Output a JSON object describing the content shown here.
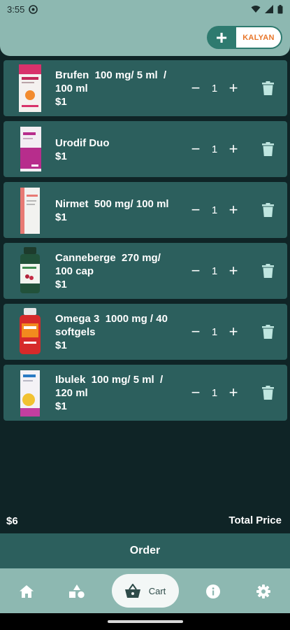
{
  "status_bar": {
    "time": "3:55",
    "icons": [
      "notification-icon",
      "wifi-icon",
      "signal-icon",
      "battery-icon"
    ]
  },
  "header": {
    "logo_plus": "+",
    "logo_text": "KALYAN"
  },
  "cart": {
    "items": [
      {
        "name": "Brufen  100 mg/ 5 ml  / 100 ml",
        "price": "$1",
        "quantity": "1",
        "thumb": "brufen-syrup-box"
      },
      {
        "name": "Urodif Duo",
        "price": "$1",
        "quantity": "1",
        "thumb": "urodif-box"
      },
      {
        "name": "Nirmet  500 mg/ 100 ml",
        "price": "$1",
        "quantity": "1",
        "thumb": "nirmet-box"
      },
      {
        "name": "Canneberge  270 mg/ 100 cap",
        "price": "$1",
        "quantity": "1",
        "thumb": "canneberge-bottle"
      },
      {
        "name": "Omega 3  1000 mg / 40 softgels",
        "price": "$1",
        "quantity": "1",
        "thumb": "omega3-bottle"
      },
      {
        "name": "Ibulek  100 mg/ 5 ml  / 120 ml",
        "price": "$1",
        "quantity": "1",
        "thumb": "ibulek-box"
      }
    ],
    "minus_glyph": "−",
    "plus_glyph": "+"
  },
  "total": {
    "amount": "$6",
    "label": "Total Price"
  },
  "order_button": "Order",
  "bottom_nav": {
    "items": [
      {
        "icon": "home-icon"
      },
      {
        "icon": "categories-icon"
      },
      {
        "icon": "cart-icon",
        "label": "Cart",
        "active": true
      },
      {
        "icon": "info-icon"
      },
      {
        "icon": "settings-icon"
      }
    ]
  },
  "colors": {
    "background": "#0f2426",
    "card": "#2c5f5d",
    "header": "#8db8b1",
    "accent": "#2e7a6f",
    "brand_text": "#e8762a"
  }
}
